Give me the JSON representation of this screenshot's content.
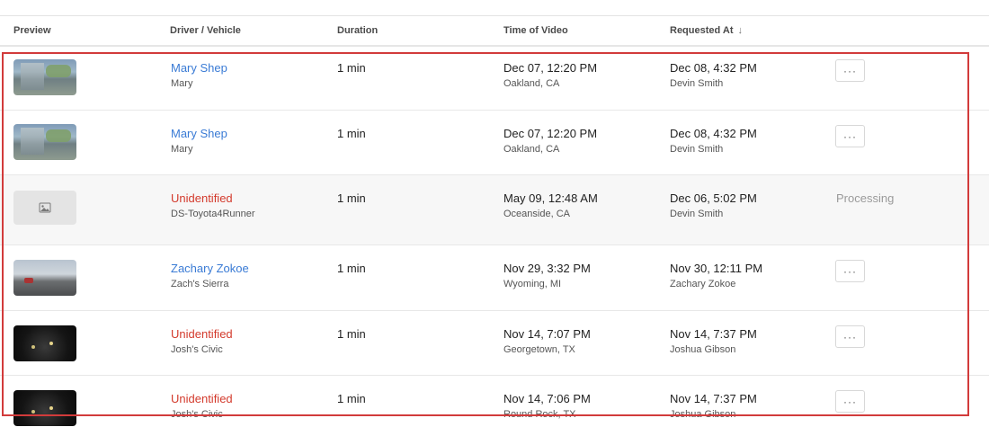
{
  "columns": {
    "preview": "Preview",
    "driver_vehicle": "Driver / Vehicle",
    "duration": "Duration",
    "time_of_video": "Time of Video",
    "requested_at": "Requested At",
    "sort_icon": "sort-down-arrow"
  },
  "menu_label": "···",
  "rows": [
    {
      "thumbnail": "house-driveway",
      "driver": "Mary Shep",
      "driver_status": "identified",
      "vehicle": "Mary",
      "duration": "1 min",
      "video_time": "Dec 07, 12:20 PM",
      "video_location": "Oakland, CA",
      "requested_time": "Dec 08, 4:32 PM",
      "requested_by": "Devin Smith"
    },
    {
      "thumbnail": "house-driveway",
      "driver": "Mary Shep",
      "driver_status": "identified",
      "vehicle": "Mary",
      "duration": "1 min",
      "video_time": "Dec 07, 12:20 PM",
      "video_location": "Oakland, CA",
      "requested_time": "Dec 08, 4:32 PM",
      "requested_by": "Devin Smith"
    },
    {
      "thumbnail": "image-placeholder-icon",
      "driver": "Unidentified",
      "driver_status": "unidentified",
      "vehicle": "DS-Toyota4Runner",
      "duration": "1 min",
      "video_time": "May 09, 12:48 AM",
      "video_location": "Oceanside, CA",
      "requested_time": "Dec 06, 5:02 PM",
      "requested_by": "Devin Smith",
      "status": "Processing"
    },
    {
      "thumbnail": "daytime-road",
      "driver": "Zachary Zokoe",
      "driver_status": "identified",
      "vehicle": "Zach's Sierra",
      "duration": "1 min",
      "video_time": "Nov 29, 3:32 PM",
      "video_location": "Wyoming, MI",
      "requested_time": "Nov 30, 12:11 PM",
      "requested_by": "Zachary Zokoe"
    },
    {
      "thumbnail": "night-road",
      "driver": "Unidentified",
      "driver_status": "unidentified",
      "vehicle": "Josh's Civic",
      "duration": "1 min",
      "video_time": "Nov 14, 7:07 PM",
      "video_location": "Georgetown, TX",
      "requested_time": "Nov 14, 7:37 PM",
      "requested_by": "Joshua Gibson"
    },
    {
      "thumbnail": "night-road",
      "driver": "Unidentified",
      "driver_status": "unidentified",
      "vehicle": "Josh's Civic",
      "duration": "1 min",
      "video_time": "Nov 14, 7:06 PM",
      "video_location": "Round Rock, TX",
      "requested_time": "Nov 14, 7:37 PM",
      "requested_by": "Joshua Gibson"
    }
  ],
  "colors": {
    "identified_driver": "#3a7bd5",
    "unidentified_driver": "#d33a2c",
    "highlight_border": "#d23b3b",
    "processing_row_bg": "#f7f7f7"
  }
}
